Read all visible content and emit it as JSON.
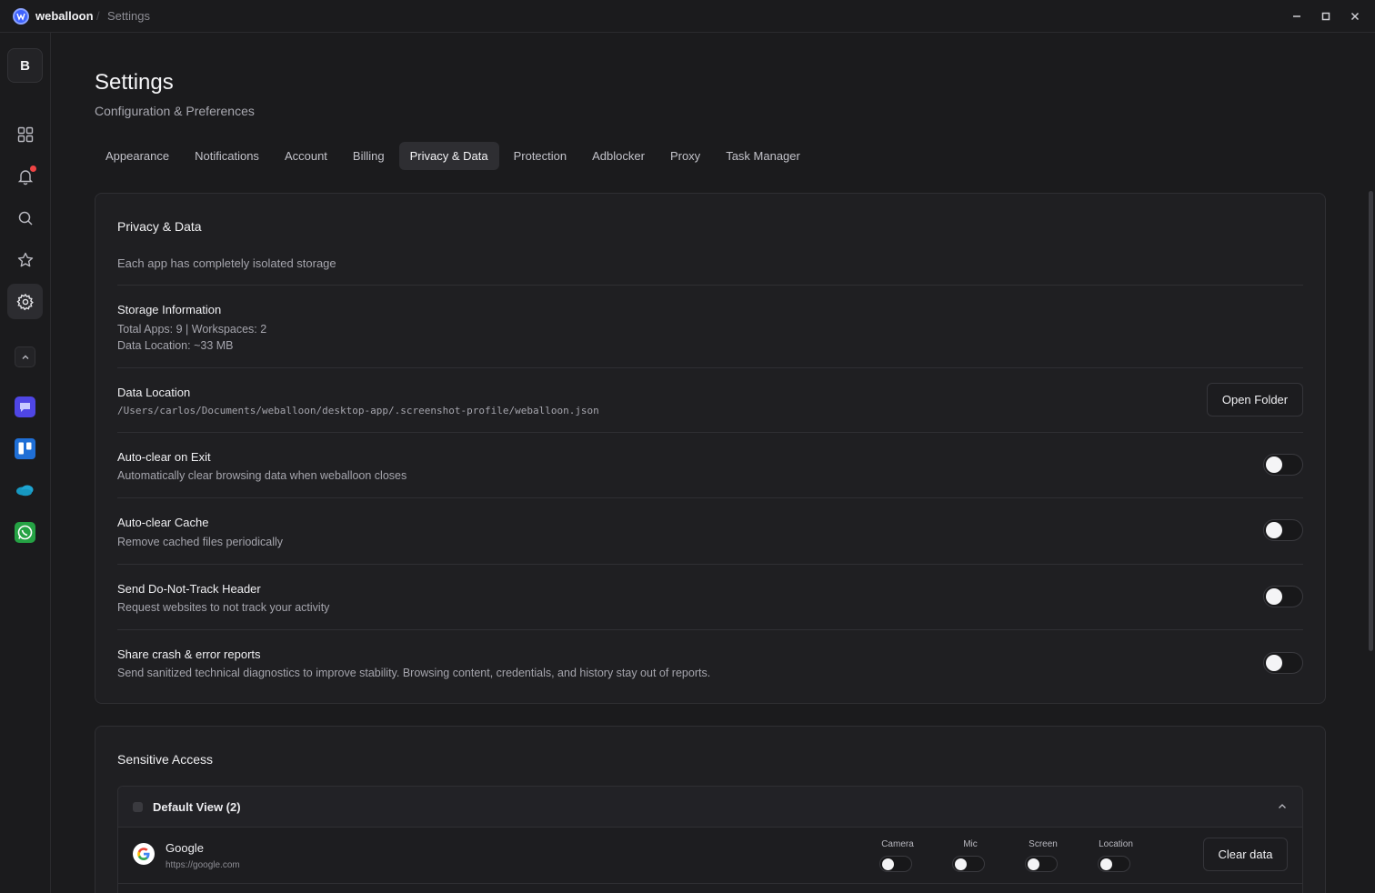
{
  "titlebar": {
    "app_name": "weballoon",
    "separator": "/",
    "crumb": "Settings"
  },
  "sidebar": {
    "profile_initial": "B",
    "icons": [
      "apps-grid-icon",
      "bell-icon",
      "search-icon",
      "star-icon",
      "gear-icon"
    ],
    "apps": [
      "chat-app-icon",
      "trello-icon",
      "salesforce-icon",
      "whatsapp-icon"
    ]
  },
  "header": {
    "title": "Settings",
    "subtitle": "Configuration & Preferences"
  },
  "tabs": [
    {
      "label": "Appearance"
    },
    {
      "label": "Notifications"
    },
    {
      "label": "Account"
    },
    {
      "label": "Billing"
    },
    {
      "label": "Privacy & Data",
      "active": true
    },
    {
      "label": "Protection"
    },
    {
      "label": "Adblocker"
    },
    {
      "label": "Proxy"
    },
    {
      "label": "Task Manager"
    }
  ],
  "privacy": {
    "title": "Privacy & Data",
    "intro": "Each app has completely isolated storage",
    "storage": {
      "label": "Storage Information",
      "line1": "Total Apps: 9 | Workspaces: 2",
      "line2": "Data Location: ~33 MB"
    },
    "data_location": {
      "label": "Data Location",
      "path": "/Users/carlos/Documents/weballoon/desktop-app/.screenshot-profile/weballoon.json",
      "button": "Open Folder"
    },
    "settings": [
      {
        "label": "Auto-clear on Exit",
        "desc": "Automatically clear browsing data when weballoon closes",
        "enabled": false
      },
      {
        "label": "Auto-clear Cache",
        "desc": "Remove cached files periodically",
        "enabled": false
      },
      {
        "label": "Send Do-Not-Track Header",
        "desc": "Request websites to not track your activity",
        "enabled": false
      },
      {
        "label": "Share crash & error reports",
        "desc": "Send sanitized technical diagnostics to improve stability. Browsing content, credentials, and history stay out of reports.",
        "enabled": false
      }
    ]
  },
  "sensitive": {
    "title": "Sensitive Access",
    "group": {
      "title": "Default View (2)",
      "sites": [
        {
          "name": "Google",
          "url": "https://google.com",
          "permissions": [
            {
              "label": "Camera",
              "enabled": false
            },
            {
              "label": "Mic",
              "enabled": false
            },
            {
              "label": "Screen",
              "enabled": false
            },
            {
              "label": "Location",
              "enabled": false
            }
          ],
          "button": "Clear data"
        }
      ]
    }
  },
  "colors": {
    "background": "#1b1b1d",
    "card": "#1f1f22",
    "accent": "#3f63ff",
    "notification": "#ef4444"
  }
}
